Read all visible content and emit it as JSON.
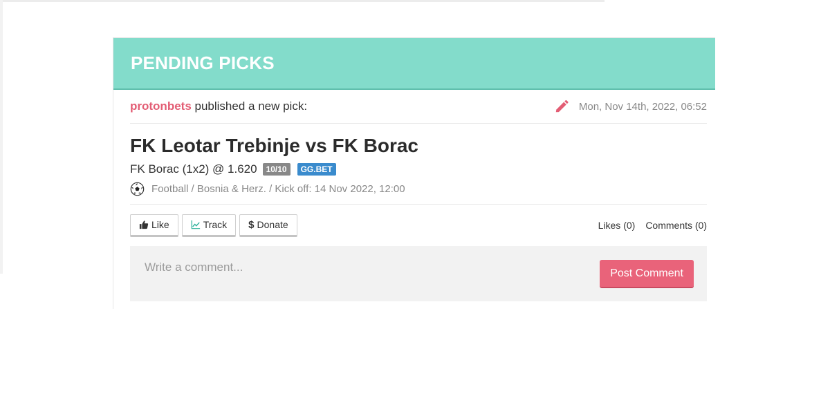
{
  "header": {
    "title": "PENDING PICKS"
  },
  "pick": {
    "username": "protonbets",
    "published_text": "published a new pick:",
    "edit_icon": "pencil-icon",
    "date": "Mon, Nov 14th, 2022, 06:52",
    "match": "FK Leotar Trebinje vs FK Borac",
    "selection": "FK Borac (1x2) @ 1.620",
    "confidence": "10/10",
    "bookmaker": "GG.BET",
    "sport_icon": "football-icon",
    "meta": "Football / Bosnia & Herz. / Kick off: 14 Nov 2022, 12:00"
  },
  "actions": {
    "like": "Like",
    "track": "Track",
    "donate": "Donate",
    "likes": "Likes (0)",
    "comments": "Comments (0)"
  },
  "comment": {
    "placeholder": "Write a comment...",
    "post_label": "Post Comment"
  },
  "colors": {
    "header_bg": "#83dccb",
    "username": "#e35d74",
    "post_button": "#e9637a",
    "bookmaker_badge": "#3a8bcd"
  }
}
